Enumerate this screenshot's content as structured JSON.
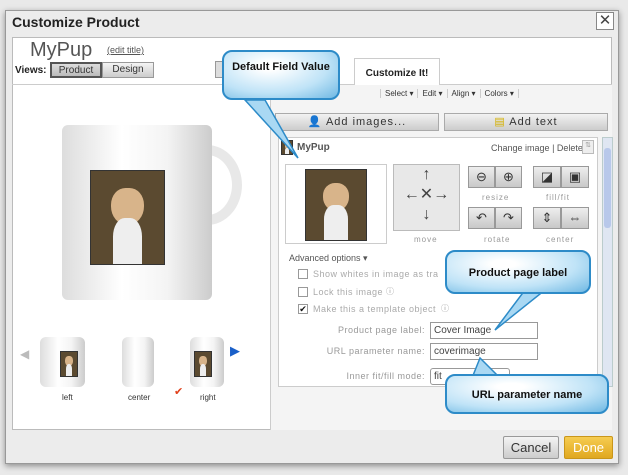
{
  "dialog": {
    "title": "Customize Product",
    "close_icon": "close-icon"
  },
  "product": {
    "name": "MyPup",
    "edit_title": "(edit title)",
    "views_label": "Views:",
    "views": [
      "Product",
      "Design"
    ],
    "selected_view": "Product"
  },
  "tabs": {
    "active": "Customize It!"
  },
  "toolbar": {
    "menus": [
      "Select ▾",
      "Edit ▾",
      "Align ▾",
      "Colors ▾"
    ]
  },
  "actions": {
    "add_images": "Add images...",
    "add_text": "Add text"
  },
  "item": {
    "name": "MyPup",
    "change_image": "Change image",
    "separator": "|",
    "delete": "Delete"
  },
  "controls": {
    "move": "move",
    "resize": "resize",
    "fill_fit": "fill/fit",
    "rotate": "rotate",
    "center": "center"
  },
  "advanced": {
    "label": "Advanced options ▾",
    "options": [
      {
        "label": "Show whites in image as tra",
        "checked": false
      },
      {
        "label": "Lock this image",
        "checked": false
      },
      {
        "label": "Make this a template object",
        "checked": true
      }
    ]
  },
  "fields": {
    "product_page_label": {
      "label": "Product page label:",
      "value": "Cover Image"
    },
    "url_param": {
      "label": "URL parameter name:",
      "value": "coverimage"
    },
    "fit_mode": {
      "label": "Inner fit/fill mode:",
      "value": "fit"
    }
  },
  "thumbnails": [
    {
      "label": "left"
    },
    {
      "label": "center"
    },
    {
      "label": "right",
      "selected": true
    }
  ],
  "callouts": {
    "default_field": "Default Field Value",
    "product_label": "Product page label",
    "url_param": "URL parameter name"
  },
  "footer": {
    "cancel": "Cancel",
    "done": "Done"
  },
  "colors": {
    "done": "#e8b32a",
    "callout": "#2d8bc8",
    "nav_arrow": "#1a5fc8"
  }
}
